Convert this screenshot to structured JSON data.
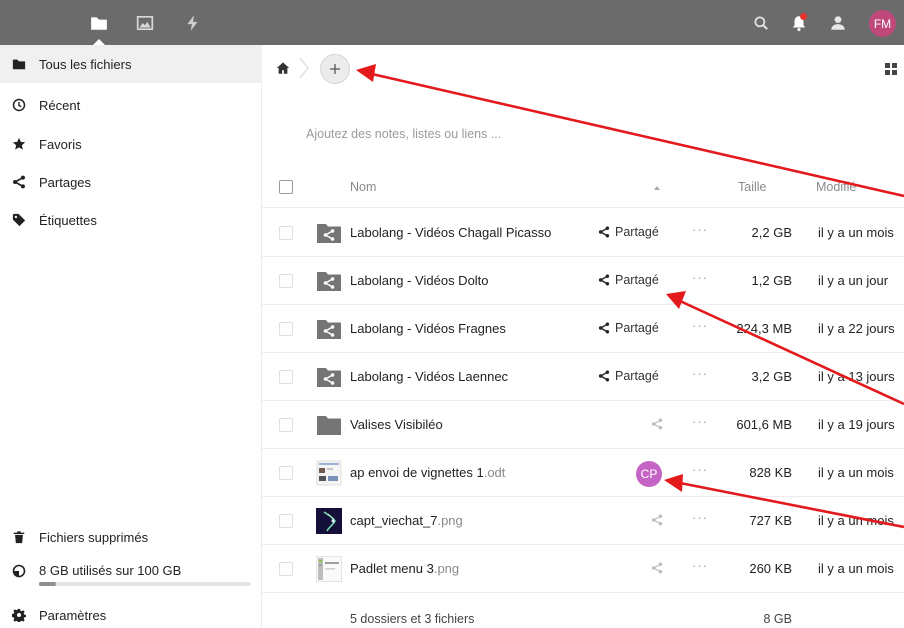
{
  "header": {
    "apps": [
      {
        "name": "files-app-icon",
        "active": true
      },
      {
        "name": "photos-app-icon",
        "active": false
      },
      {
        "name": "activity-app-icon",
        "active": false
      }
    ],
    "avatar_initials": "FM",
    "avatar_color": "#c0487a"
  },
  "sidebar": {
    "items": [
      {
        "label": "Tous les fichiers",
        "icon": "folder-icon"
      },
      {
        "label": "Récent",
        "icon": "clock-icon"
      },
      {
        "label": "Favoris",
        "icon": "star-icon"
      },
      {
        "label": "Partages",
        "icon": "share-icon"
      },
      {
        "label": "Étiquettes",
        "icon": "tag-icon"
      }
    ],
    "deleted_files": "Fichiers supprimés",
    "quota_text": "8 GB utilisés sur 100 GB",
    "quota_fraction": 0.08,
    "settings": "Paramètres"
  },
  "main": {
    "notes_placeholder": "Ajoutez des notes, listes ou liens ...",
    "columns": {
      "name": "Nom",
      "size": "Taille",
      "modified": "Modifié"
    },
    "files": [
      {
        "name": "Labolang - Vidéos Chagall Picasso",
        "ext": "",
        "type": "shared-folder",
        "share": "Partagé",
        "size": "2,2 GB",
        "modified": "il y a un mois"
      },
      {
        "name": "Labolang - Vidéos Dolto",
        "ext": "",
        "type": "shared-folder",
        "share": "Partagé",
        "size": "1,2 GB",
        "modified": "il y a un jour"
      },
      {
        "name": "Labolang - Vidéos Fragnes",
        "ext": "",
        "type": "shared-folder",
        "share": "Partagé",
        "size": "224,3 MB",
        "modified": "il y a 22 jours"
      },
      {
        "name": "Labolang - Vidéos Laennec",
        "ext": "",
        "type": "shared-folder",
        "share": "Partagé",
        "size": "3,2 GB",
        "modified": "il y a 13 jours"
      },
      {
        "name": "Valises Visibiléo",
        "ext": "",
        "type": "folder",
        "share": "",
        "size": "601,6 MB",
        "modified": "il y a 19 jours"
      },
      {
        "name": "ap envoi de vignettes 1",
        "ext": ".odt",
        "type": "document",
        "share": "",
        "avatar": "CP",
        "size": "828 KB",
        "modified": "il y a un mois"
      },
      {
        "name": "capt_viechat_7",
        "ext": ".png",
        "type": "image-dark",
        "share": "",
        "size": "727 KB",
        "modified": "il y a un mois"
      },
      {
        "name": "Padlet menu 3",
        "ext": ".png",
        "type": "image-light",
        "share": "",
        "size": "260 KB",
        "modified": "il y a un mois"
      }
    ],
    "summary": {
      "text": "5 dossiers et 3 fichiers",
      "size": "8 GB"
    }
  },
  "colors": {
    "header_bg": "#6b6b6b",
    "folder_gray": "#757575",
    "cp_avatar": "#c664c6",
    "annotation_red": "#e3191c"
  }
}
